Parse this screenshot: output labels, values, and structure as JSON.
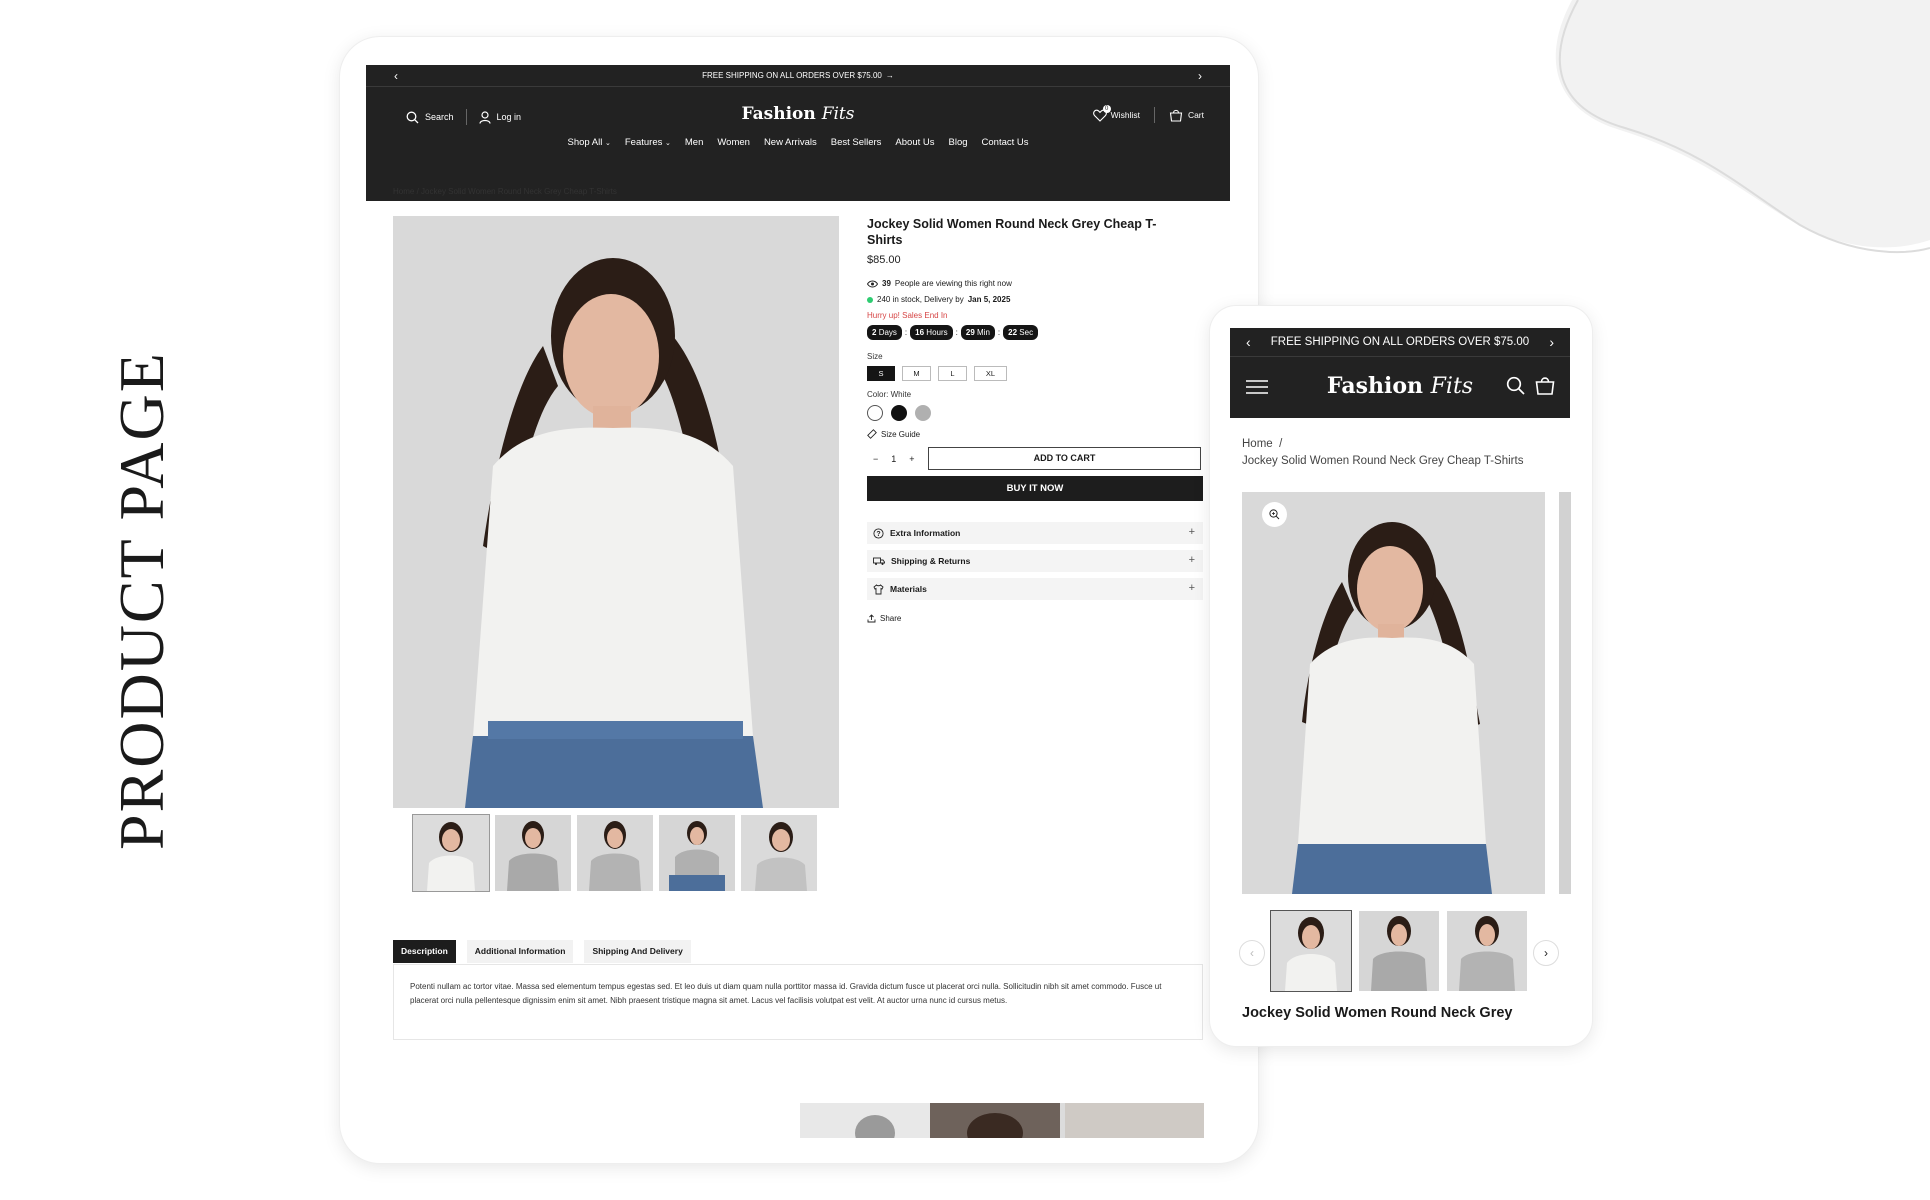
{
  "side_title": "PRODUCT PAGE",
  "desktop": {
    "announcement": "FREE SHIPPING ON ALL ORDERS OVER $75.00",
    "header": {
      "search_label": "Search",
      "login_label": "Log in",
      "logo_main": "Fashion",
      "logo_italic": "Fits",
      "wishlist_label": "Wishlist",
      "wishlist_count": "0",
      "cart_label": "Cart"
    },
    "nav": [
      "Shop All",
      "Features",
      "Men",
      "Women",
      "New Arrivals",
      "Best Sellers",
      "About Us",
      "Blog",
      "Contact Us"
    ],
    "breadcrumb": {
      "home": "Home",
      "sep": "/",
      "current": "Jockey Solid Women Round Neck Grey Cheap T-Shirts"
    },
    "product": {
      "title": "Jockey Solid Women Round Neck Grey Cheap T-Shirts",
      "price": "$85.00",
      "viewers_count": "39",
      "viewers_text": "People are viewing this right now",
      "stock_text": "240 in stock, Delivery by",
      "delivery_date": "Jan 5, 2025",
      "hurry_text": "Hurry up! Sales End In",
      "timer": [
        {
          "value": "2",
          "unit": "Days"
        },
        {
          "value": "16",
          "unit": "Hours"
        },
        {
          "value": "29",
          "unit": "Min"
        },
        {
          "value": "22",
          "unit": "Sec"
        }
      ],
      "timer_sep": ":",
      "size_label": "Size",
      "sizes": [
        "S",
        "M",
        "L",
        "XL"
      ],
      "selected_size": "S",
      "color_label": "Color: White",
      "colors": [
        "#ffffff",
        "#111111",
        "#b0b0b0"
      ],
      "size_guide": "Size Guide",
      "qty_minus": "−",
      "qty_value": "1",
      "qty_plus": "+",
      "add_to_cart": "ADD TO CART",
      "buy_now": "BUY IT NOW",
      "accordions": [
        "Extra Information",
        "Shipping & Returns",
        "Materials"
      ],
      "accordion_plus": "+",
      "share": "Share"
    },
    "tabs": [
      "Description",
      "Additional Information",
      "Shipping And Delivery"
    ],
    "description": "Potenti nullam ac tortor vitae. Massa sed elementum tempus egestas sed. Et leo duis ut diam quam nulla porttitor massa id. Gravida dictum fusce ut placerat orci nulla. Sollicitudin nibh sit amet commodo. Fusce ut placerat orci nulla pellentesque dignissim enim sit amet. Nibh praesent tristique magna sit amet. Lacus vel facilisis volutpat est velit. At auctor urna nunc id cursus metus."
  },
  "mobile": {
    "announcement": "FREE SHIPPING ON ALL ORDERS OVER $75.00",
    "logo_main": "Fashion",
    "logo_italic": "Fits",
    "breadcrumb_home": "Home",
    "breadcrumb_sep": "/",
    "breadcrumb_current": "Jockey Solid Women Round Neck Grey Cheap T-Shirts",
    "product_title": "Jockey Solid Women Round Neck Grey"
  },
  "colors": {
    "header_bg": "#222222",
    "accent_dark": "#1d1d1d",
    "sale_red": "#d64545",
    "stock_green": "#2ecc71"
  }
}
